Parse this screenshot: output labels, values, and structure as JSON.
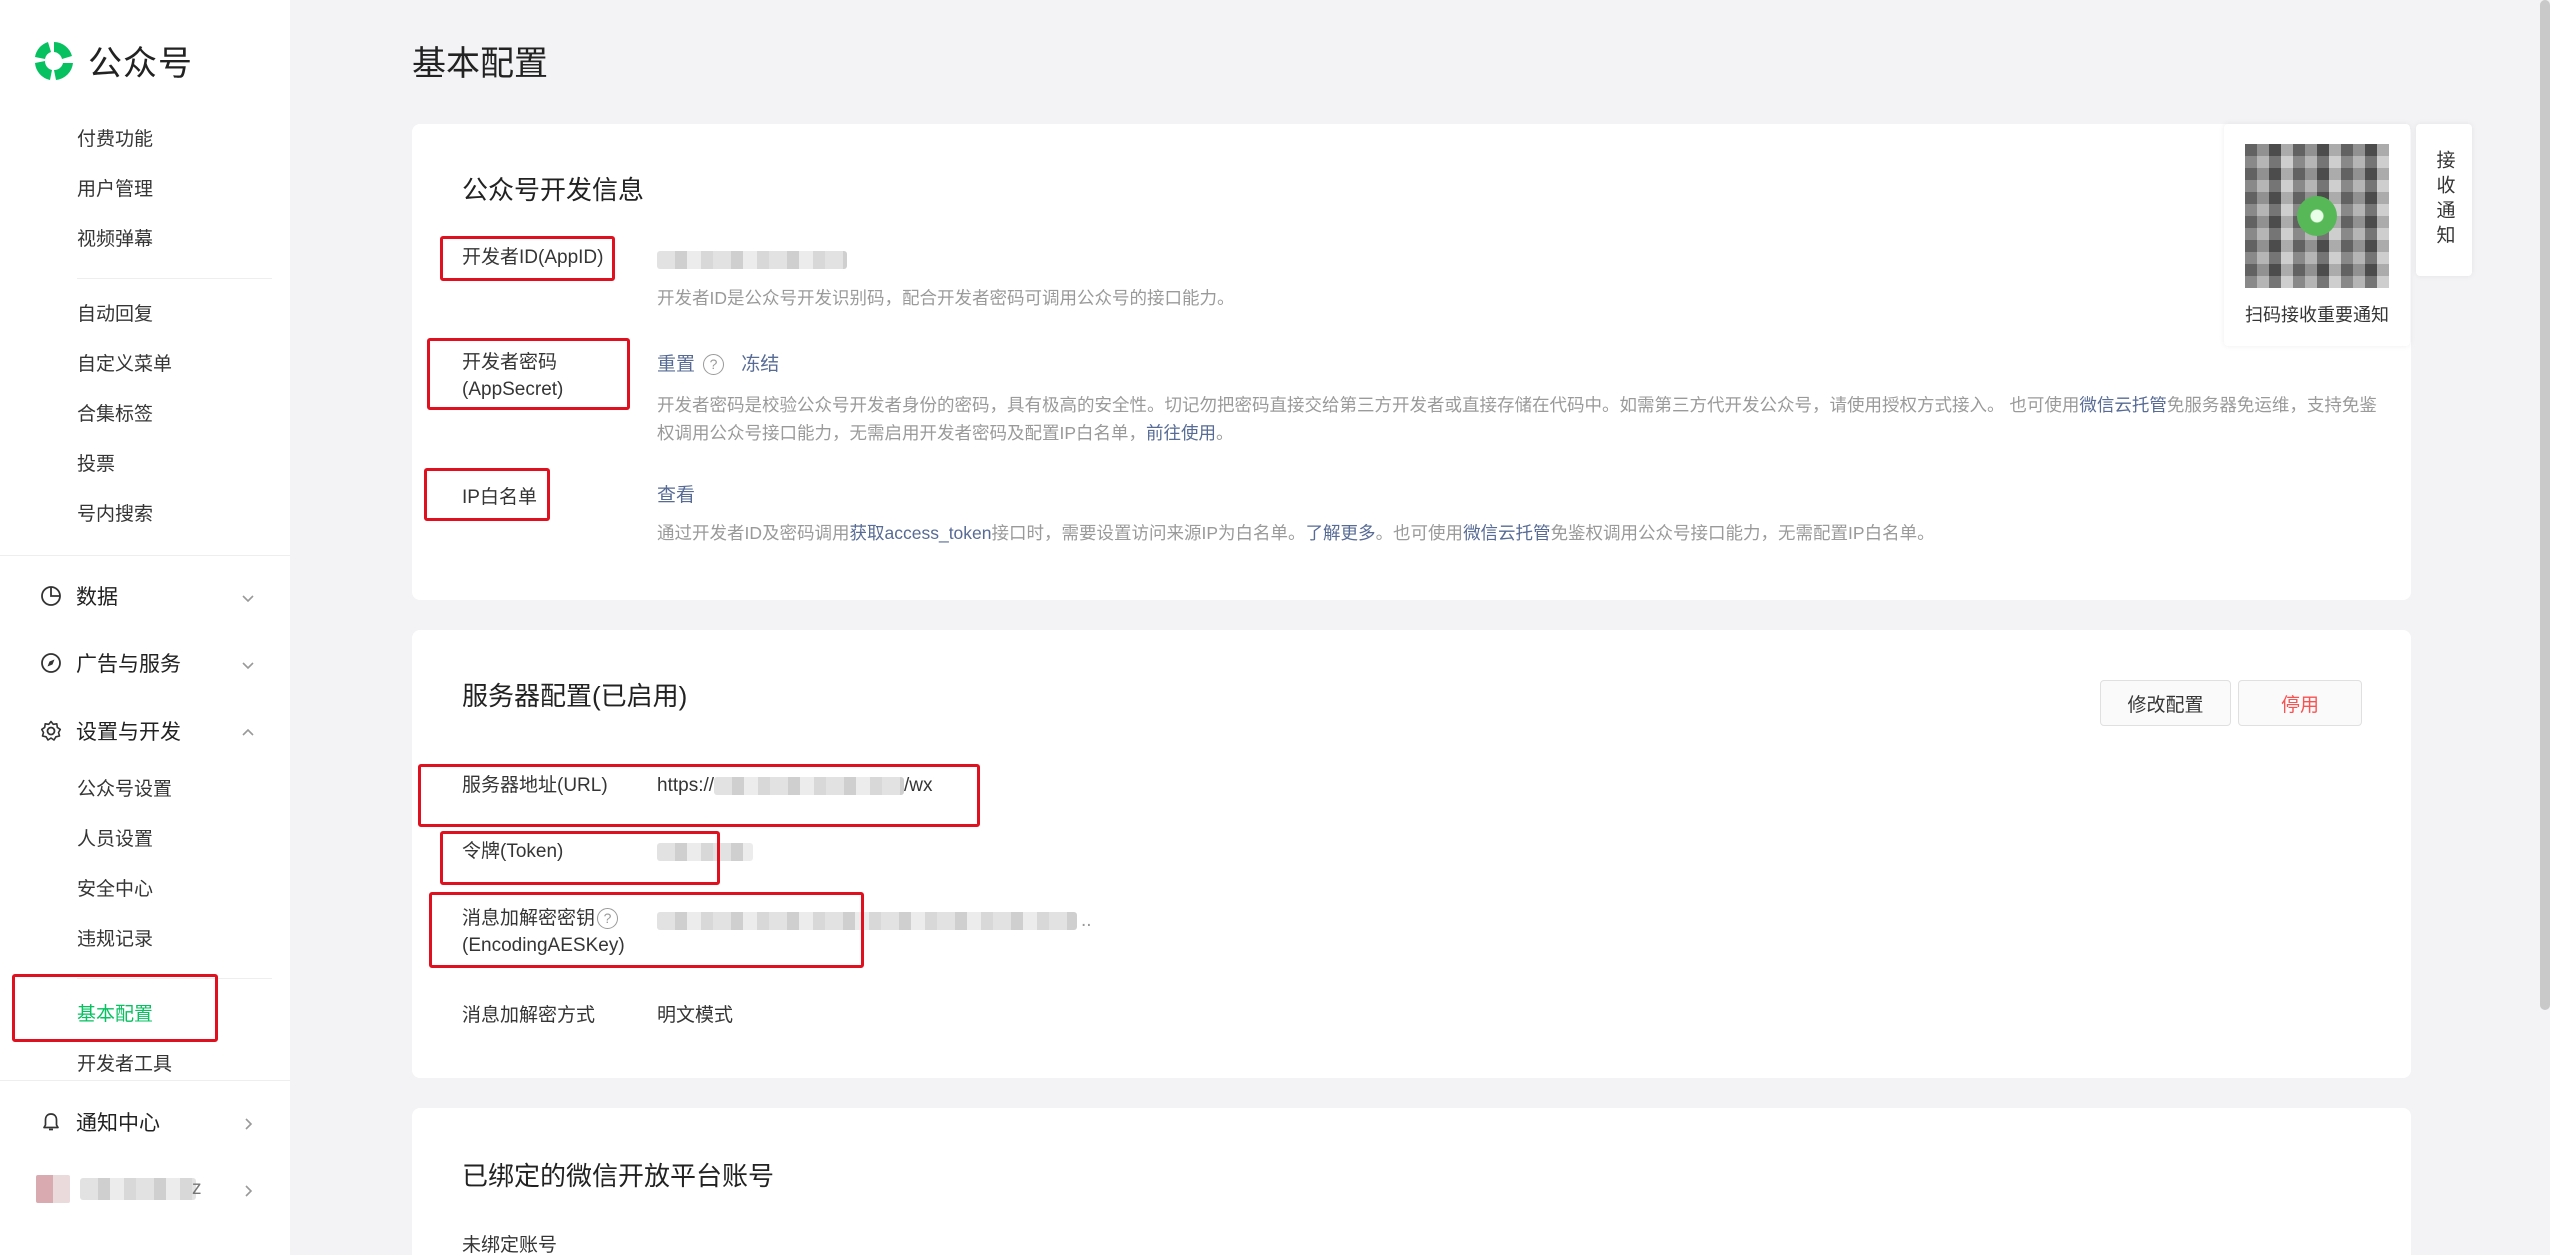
{
  "app": {
    "title": "公众号"
  },
  "sidebar": {
    "items_top": [
      "付费功能",
      "用户管理",
      "视频弹幕",
      "自动回复",
      "自定义菜单",
      "合集标签",
      "投票",
      "号内搜索"
    ],
    "groups": {
      "data": "数据",
      "ads": "广告与服务",
      "settings": "设置与开发"
    },
    "settings_items": [
      "公众号设置",
      "人员设置",
      "安全中心",
      "违规记录",
      "基本配置",
      "开发者工具"
    ],
    "active_item": "基本配置",
    "notify": "通知中心",
    "user_suffix": "z"
  },
  "page": {
    "title": "基本配置"
  },
  "dev_info": {
    "title": "公众号开发信息",
    "appid_label": "开发者ID(AppID)",
    "appid_desc": "开发者ID是公众号开发识别码，配合开发者密码可调用公众号的接口能力。",
    "secret_label": "开发者密码(AppSecret)",
    "reset_link": "重置",
    "help_glyph": "?",
    "freeze_link": "冻结",
    "secret_desc_1": "开发者密码是校验公众号开发者身份的密码，具有极高的安全性。切记勿把密码直接交给第三方开发者或直接存储在代码中。如需第三方代开发公众号，请使用授权方式接入。 也可使用",
    "secret_desc_link_1": "微信云托管",
    "secret_desc_2": "免服务器免运维，支持免鉴权调用公众号接口能力，无需启用开发者密码及配置IP白名单，",
    "secret_desc_link_2": "前往使用",
    "secret_desc_3": "。",
    "ip_label": "IP白名单",
    "ip_view": "查看",
    "ip_desc_1": "通过开发者ID及密码调用",
    "ip_desc_link_1": "获取access_token",
    "ip_desc_2": "接口时，需要设置访问来源IP为白名单。",
    "ip_desc_link_2": "了解更多",
    "ip_desc_3": "。也可使用",
    "ip_desc_link_3": "微信云托管",
    "ip_desc_4": "免鉴权调用公众号接口能力，无需配置IP白名单。"
  },
  "qr": {
    "caption": "扫码接收重要通知",
    "tab": "接收通知"
  },
  "server": {
    "title": "服务器配置(已启用)",
    "modify_button": "修改配置",
    "disable_button": "停用",
    "url_label": "服务器地址(URL)",
    "url_prefix": "https://",
    "url_suffix": "/wx",
    "token_label": "令牌(Token)",
    "aes_label_1": "消息加解密密钥",
    "aes_label_2": "(EncodingAESKey)",
    "aes_tail": "..",
    "mode_label": "消息加解密方式",
    "mode_value": "明文模式"
  },
  "bound": {
    "title": "已绑定的微信开放平台账号",
    "value": "未绑定账号"
  },
  "colors": {
    "brand": "#07c160",
    "link": "#576b95",
    "danger": "#fa5151",
    "highlight": "#e0101e"
  },
  "icons": [
    "wechat-official-logo-icon",
    "data-chart-icon",
    "compass-icon",
    "gear-icon",
    "bell-icon",
    "chevron-down-icon",
    "chevron-up-icon",
    "chevron-right-icon",
    "help-circle-icon"
  ]
}
